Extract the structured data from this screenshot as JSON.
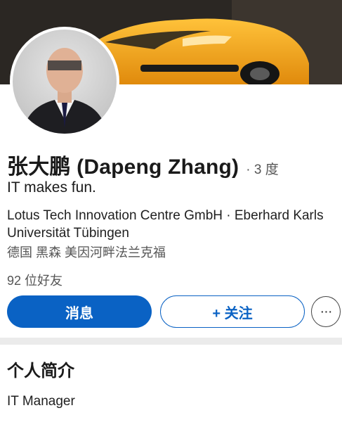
{
  "profile": {
    "name": "张大鹏 (Dapeng Zhang)",
    "degree": "· 3 度",
    "headline": "IT makes fun.",
    "company": "Lotus Tech Innovation Centre GmbH · Eberhard Karls Universität Tübingen",
    "location": "德国 黑森 美因河畔法兰克福",
    "connections": "92 位好友"
  },
  "actions": {
    "message_label": "消息",
    "follow_label": "+ 关注",
    "more_label": "···"
  },
  "about": {
    "title": "个人简介",
    "text": "IT Manager"
  },
  "icons": {
    "avatar": "profile-photo",
    "cover": "cover-photo-car",
    "more": "more-dots-icon"
  },
  "colors": {
    "primary": "#0a62c4",
    "cover_car": "#f2a81c"
  }
}
